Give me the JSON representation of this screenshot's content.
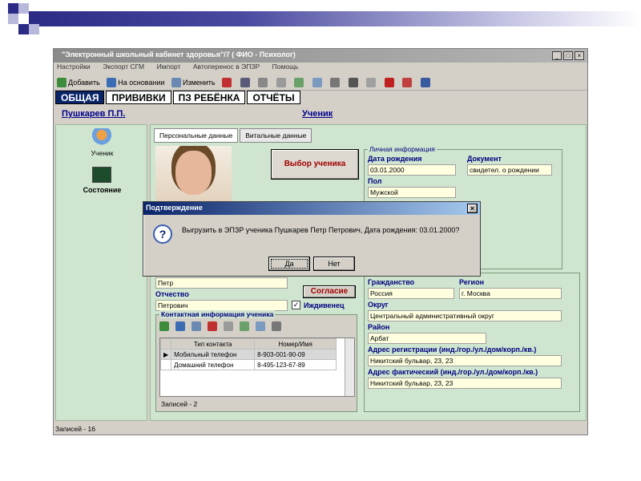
{
  "window": {
    "title": "\"Электронный школьный кабинет здоровья\"/7 ( ФИО - Психолог)",
    "controls": [
      "_",
      "□",
      "×"
    ]
  },
  "menu": [
    "Настройки",
    "Экспорт СГМ",
    "Импорт",
    "Автоперенос в ЭПЗР",
    "Помощь"
  ],
  "toolbar": {
    "add": "Добавить",
    "based_on": "На основании",
    "edit": "Изменить"
  },
  "main_tabs": [
    "ОБЩАЯ",
    "ПРИВИВКИ",
    "ПЗ РЕБЁНКА",
    "ОТЧЁТЫ"
  ],
  "header": {
    "person": "Пушкарев П.П.",
    "role": "Ученик"
  },
  "left_panel": {
    "student": "Ученик",
    "state": "Состояние"
  },
  "sub_tabs": [
    "Персональные данные",
    "Витальные данные"
  ],
  "select_student": "Выбор ученика",
  "personal_info": {
    "title": "Личная информация",
    "birth_label": "Дата рождения",
    "birth_value": "03.01.2000",
    "doc_label": "Документ",
    "doc_value": "свидетел. о рождении",
    "sex_label": "Пол",
    "sex_value": "Мужской"
  },
  "name": {
    "first_value": "Петр",
    "patronymic_label": "Отчество",
    "patronymic_value": "Петрович",
    "consent": "Согласие",
    "dependent": "Иждивенец"
  },
  "contacts": {
    "title": "Контактная информация ученика",
    "col_type": "Тип контакта",
    "col_number": "Номер/Имя",
    "rows": [
      {
        "type": "Мобильный телефон",
        "number": "8-903-001-90-09"
      },
      {
        "type": "Домашний телефон",
        "number": "8-495-123-67-89"
      }
    ],
    "records": "Записей - 2"
  },
  "address": {
    "citizenship_label": "Гражданство",
    "citizenship_value": "Россия",
    "region_label": "Регион",
    "region_value": "г. Москва",
    "district_label": "Округ",
    "district_value": "Центральный административный округ",
    "area_label": "Район",
    "area_value": "Арбат",
    "reg_label": "Адрес регистрации (инд./гор./ул./дом/корп./кв.)",
    "reg_value": "Никитский бульвар, 23, 23",
    "actual_label": "Адрес фактический (инд./гор./ул./дом/корп./кв.)",
    "actual_value": "Никитский бульвар, 23, 23"
  },
  "status": "Записей - 16",
  "dialog": {
    "title": "Подтверждение",
    "message": "Выгрузить в ЭПЗР ученика Пушкарев Петр Петрович, Дата рождения: 03.01.2000?",
    "yes": "Да",
    "no": "Нет",
    "close": "×"
  }
}
